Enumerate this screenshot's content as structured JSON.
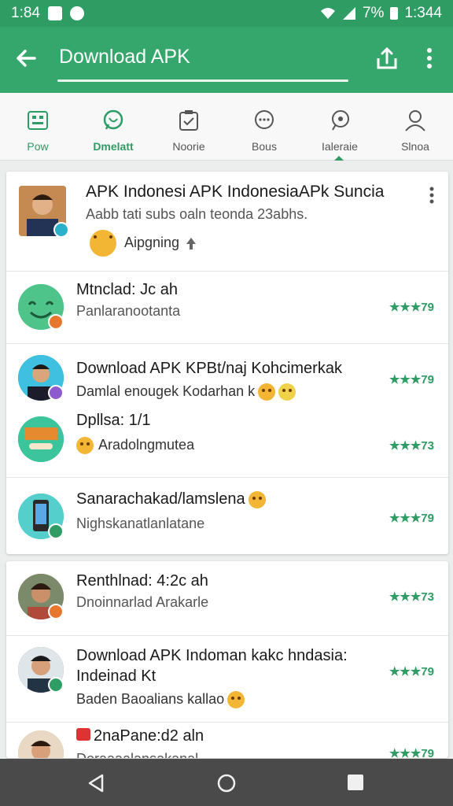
{
  "status_bar": {
    "time_left": "1:84",
    "battery_percent": "7%",
    "time_right": "1:344"
  },
  "app_bar": {
    "title": "Download APK"
  },
  "tabs": [
    {
      "label": "Pow",
      "icon": "grid-icon",
      "active": false
    },
    {
      "label": "Dmelatt",
      "icon": "whatsapp-icon",
      "active": true
    },
    {
      "label": "Noorie",
      "icon": "clipboard-icon",
      "active": false
    },
    {
      "label": "Bous",
      "icon": "chat-icon",
      "active": false
    },
    {
      "label": "Ialeraie",
      "icon": "help-chat-icon",
      "active": false
    },
    {
      "label": "Slnoa",
      "icon": "profile-icon",
      "active": false
    }
  ],
  "featured": {
    "title": "APK Indonesi APK IndonesiaAPk Suncia",
    "subtitle": "Aabb tati subs oaln teonda 23abhs.",
    "reaction_text": "Aipgning"
  },
  "list_items": [
    {
      "title": "Mtnclad: Jc ah",
      "subtitle": "Panlaranootanta",
      "rating": "★★★79"
    },
    {
      "title": "Download APK KPBt/naj Kohcimerkak",
      "subtitle": "Damlal enougek Kodarhan k",
      "rating": "★★★79"
    },
    {
      "title": "Dpllsa: 1/1",
      "subtitle": "Aradolngmutea",
      "rating": "★★★73"
    },
    {
      "title": "Sanarachakad/lamslena",
      "subtitle": "Nighskanatlanlatane",
      "rating": "★★★79"
    },
    {
      "title": "Renthlnad: 4:2c ah",
      "subtitle": "Dnoinnarlad Arakarle",
      "rating": "★★★73"
    },
    {
      "title": "Download APK Indoman kakc hndasia: Indeinad Kt",
      "subtitle": "Baden Baoalians kallao",
      "rating": "★★★79"
    },
    {
      "title": "2naPane:d2 aln",
      "subtitle": "Doraaaalansakanal",
      "rating": "★★★79"
    }
  ],
  "colors": {
    "primary": "#35a76c",
    "primary_dark": "#2e9c63",
    "rating": "#2e9c63"
  }
}
